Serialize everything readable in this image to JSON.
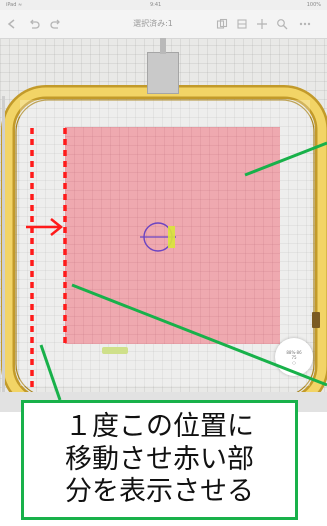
{
  "status_bar": {
    "left": "iPad ≈",
    "center": "9:41",
    "right": "100%"
  },
  "toolbar": {
    "title": "選択済み:1",
    "left_icons": [
      "back-arrow-icon",
      "undo-icon",
      "redo-icon"
    ],
    "right_icons": [
      "copy-icon",
      "settings-icon",
      "move-icon",
      "zoom-icon",
      "more-icon"
    ]
  },
  "canvas": {
    "design_color": "#f0a6ad",
    "hoop_color": "#e8c54a"
  },
  "side_button": {
    "line1": "88%·86",
    "line2": "75",
    "line3": "○"
  },
  "annotation": {
    "text": "１度この位置に\n移動させ赤い部\n分を表示させる",
    "marker_color": "#ff1a1a",
    "callout_color": "#18b14a"
  }
}
